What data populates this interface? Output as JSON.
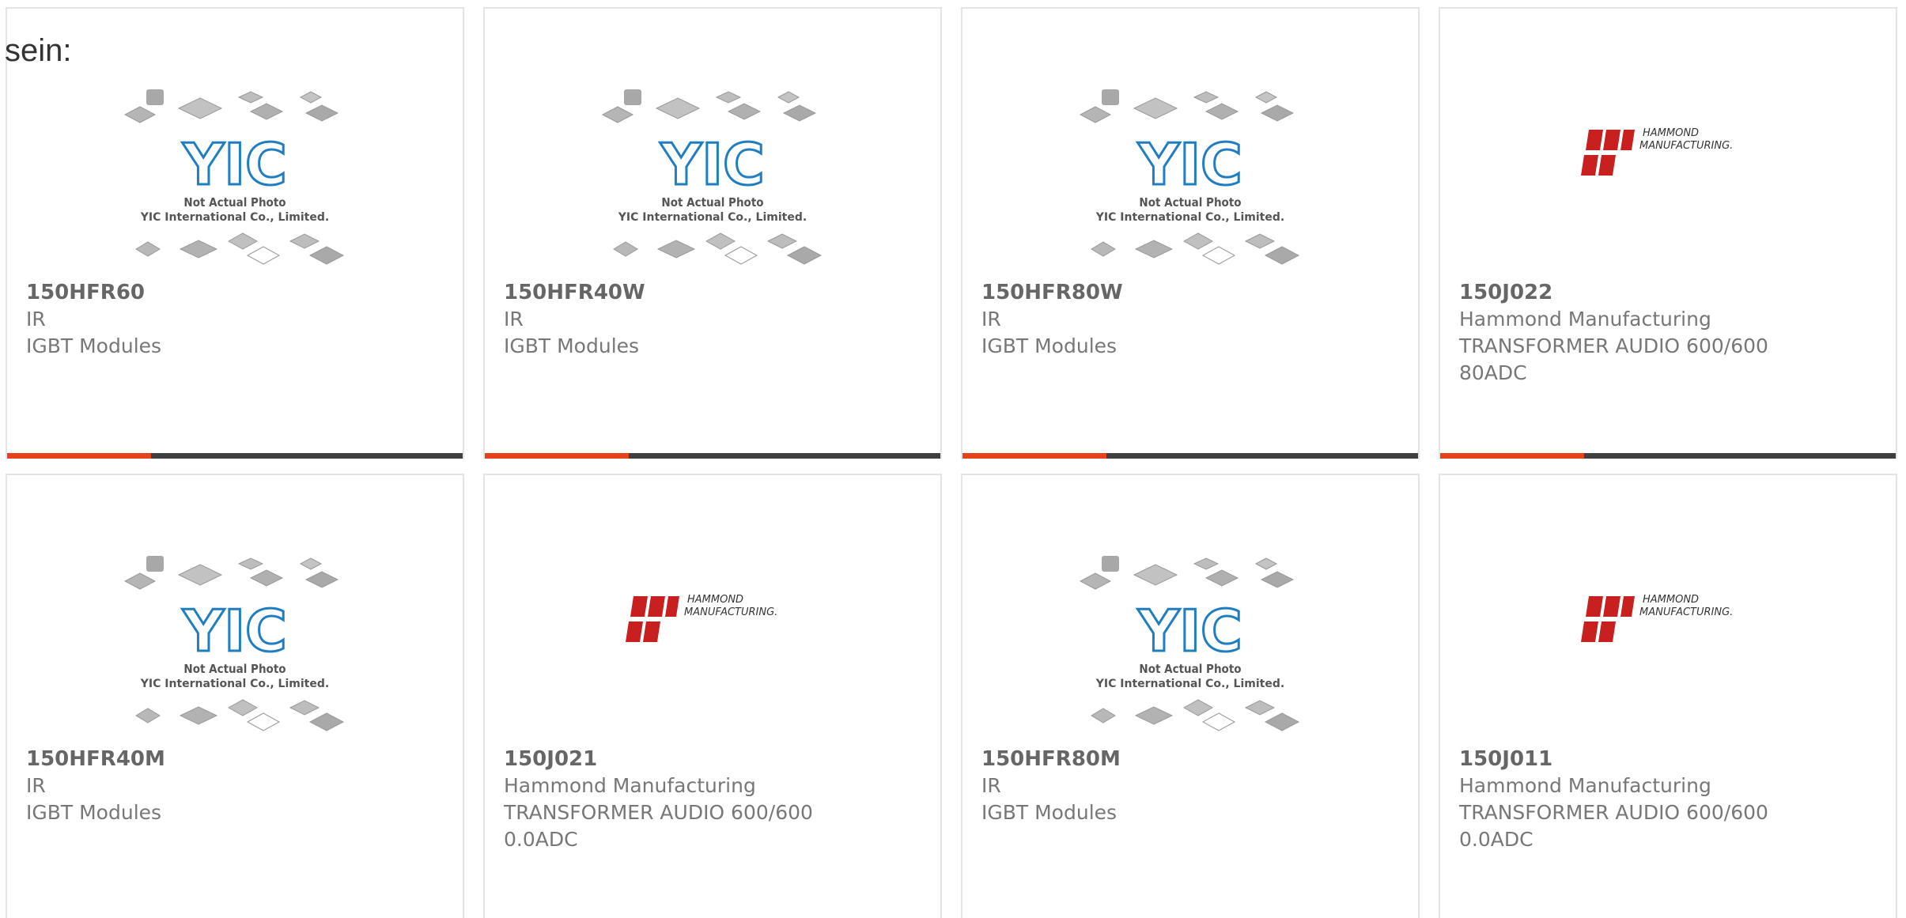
{
  "intro": {
    "text": "sein:"
  },
  "colors": {
    "accent": "#e5421b",
    "bar": "#3f3f3f",
    "yic_blue": "#1f7ec1",
    "hammond_red": "#c8201f"
  },
  "cards": [
    {
      "part": "150HFR60",
      "maker": "IR",
      "desc": "IGBT Modules",
      "desc2": "",
      "image": "yic",
      "yic_line1": "Not Actual Photo",
      "yic_line2": "YIC International Co., Limited."
    },
    {
      "part": "150HFR40W",
      "maker": "IR",
      "desc": "IGBT Modules",
      "desc2": "",
      "image": "yic",
      "yic_line1": "Not Actual Photo",
      "yic_line2": "YIC International Co., Limited."
    },
    {
      "part": "150HFR80W",
      "maker": "IR",
      "desc": "IGBT Modules",
      "desc2": "",
      "image": "yic",
      "yic_line1": "Not Actual Photo",
      "yic_line2": "YIC International Co., Limited."
    },
    {
      "part": "150J022",
      "maker": "Hammond Manufacturing",
      "desc": "TRANSFORMER AUDIO 600/600",
      "desc2": "80ADC",
      "image": "hammond",
      "logo_line1": "HAMMOND",
      "logo_line2": "MANUFACTURING."
    },
    {
      "part": "150HFR40M",
      "maker": "IR",
      "desc": "IGBT Modules",
      "desc2": "",
      "image": "yic",
      "yic_line1": "Not Actual Photo",
      "yic_line2": "YIC International Co., Limited."
    },
    {
      "part": "150J021",
      "maker": "Hammond Manufacturing",
      "desc": "TRANSFORMER AUDIO 600/600",
      "desc2": "0.0ADC",
      "image": "hammond",
      "logo_line1": "HAMMOND",
      "logo_line2": "MANUFACTURING."
    },
    {
      "part": "150HFR80M",
      "maker": "IR",
      "desc": "IGBT Modules",
      "desc2": "",
      "image": "yic",
      "yic_line1": "Not Actual Photo",
      "yic_line2": "YIC International Co., Limited."
    },
    {
      "part": "150J011",
      "maker": "Hammond Manufacturing",
      "desc": "TRANSFORMER AUDIO 600/600",
      "desc2": "0.0ADC",
      "image": "hammond",
      "logo_line1": "HAMMOND",
      "logo_line2": "MANUFACTURING."
    }
  ]
}
